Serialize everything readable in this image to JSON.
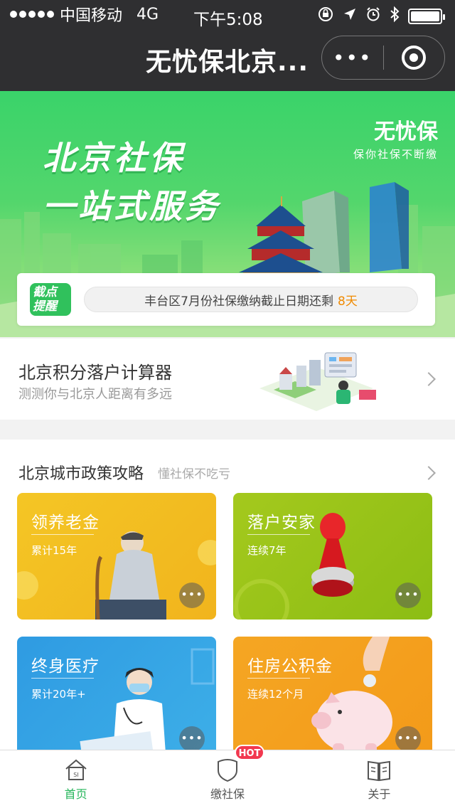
{
  "status_bar": {
    "carrier": "中国移动",
    "network": "4G",
    "time": "下午5:08"
  },
  "nav": {
    "title": "无忧保北京...",
    "more_glyph": "•••"
  },
  "banner": {
    "line1": "北京社保",
    "line2": "一站式服务",
    "brand_name": "无忧保",
    "brand_slogan": "保你社保不断缴",
    "notice_badge_line1": "截点",
    "notice_badge_line2": "提醒",
    "notice_text": "丰台区7月份社保缴纳截止日期还剩",
    "notice_days": "8天"
  },
  "calculator": {
    "title": "北京积分落户计算器",
    "subtitle": "测测你与北京人距离有多远"
  },
  "policy": {
    "title": "北京城市政策攻略",
    "subtitle": "懂社保不吃亏",
    "cards": [
      {
        "title": "领养老金",
        "desc": "累计15年"
      },
      {
        "title": "落户安家",
        "desc": "连续7年"
      },
      {
        "title": "终身医疗",
        "desc": "累计20年+"
      },
      {
        "title": "住房公积金",
        "desc": "连续12个月"
      }
    ],
    "more_glyph": "•••"
  },
  "tabbar": {
    "items": [
      {
        "label": "首页",
        "icon": "home-icon"
      },
      {
        "label": "缴社保",
        "icon": "shield-icon",
        "badge": "HOT"
      },
      {
        "label": "关于",
        "icon": "book-icon"
      }
    ],
    "home_icon_text": "SI"
  },
  "colors": {
    "accent": "#24b55a",
    "banner_green": "#3ad36a",
    "notice_days": "#f08a00",
    "hot_badge": "#f2384f"
  }
}
